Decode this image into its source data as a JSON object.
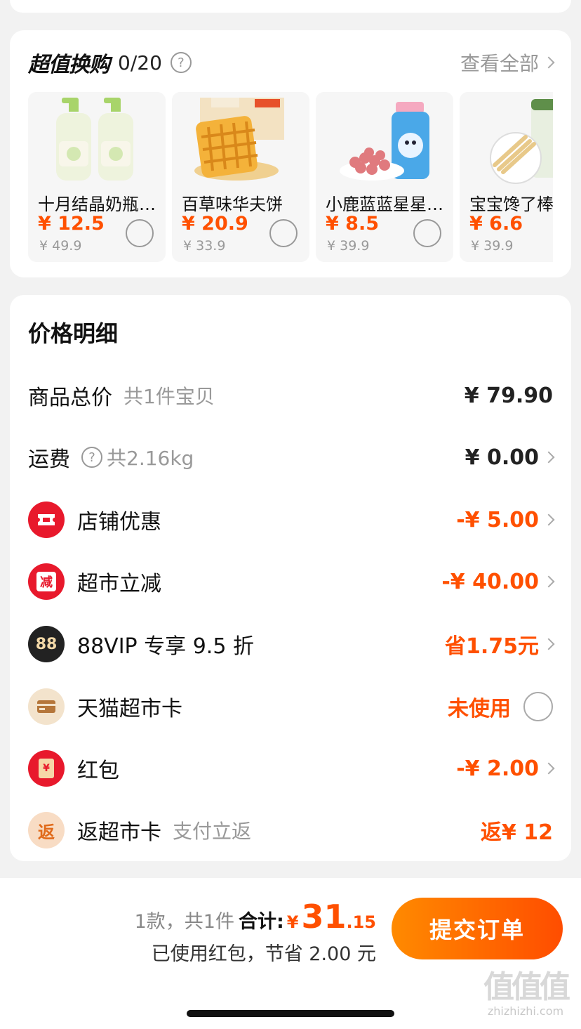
{
  "exchange": {
    "title": "超值换购",
    "count": "0/20",
    "help": "?",
    "view_all": "查看全部",
    "products": [
      {
        "name": "十月结晶奶瓶清洗剂",
        "price": "¥ 12.5",
        "orig": "¥ 49.9",
        "icon": "bottle-cleaner-image"
      },
      {
        "name": "百草味华夫饼",
        "price": "¥ 20.9",
        "orig": "¥ 33.9",
        "icon": "waffle-image"
      },
      {
        "name": "小鹿蓝蓝星星泡芙",
        "price": "¥ 8.5",
        "orig": "¥ 39.9",
        "icon": "puffs-image"
      },
      {
        "name": "宝宝馋了棒",
        "price": "¥ 6.6",
        "orig": "¥ 39.9",
        "icon": "baby-sticks-image"
      }
    ]
  },
  "price_detail": {
    "title": "价格明细",
    "rows": [
      {
        "label": "商品总价",
        "sub": "共1件宝贝",
        "value": "¥ 79.90"
      },
      {
        "label": "运费",
        "help": "?",
        "sub": "共2.16kg",
        "value": "¥ 0.00"
      },
      {
        "label": "店铺优惠",
        "value": "-¥ 5.00",
        "icon": "coupon-icon"
      },
      {
        "label": "超市立减",
        "value": "-¥ 40.00",
        "icon": "reduce-icon",
        "icon_text": "减"
      },
      {
        "label": "88VIP 专享 9.5 折",
        "value": "省1.75元",
        "icon": "vip-88-icon",
        "icon_text": "88"
      },
      {
        "label": "天猫超市卡",
        "value": "未使用",
        "icon": "card-icon"
      },
      {
        "label": "红包",
        "value": "-¥ 2.00",
        "icon": "red-packet-icon",
        "icon_text": "¥"
      },
      {
        "label": "返超市卡",
        "sub": "支付立返",
        "value": "返¥ 12",
        "icon": "cashback-icon",
        "icon_text": "返"
      }
    ]
  },
  "summary": {
    "count": "1款，共1件",
    "total_label": "合计:",
    "yen": "¥",
    "total_int": "31",
    "total_dec": ".15",
    "saved": "已使用红包，节省 2.00 元",
    "submit": "提交订单"
  },
  "watermark": {
    "logo": "值值值",
    "url": "zhizhizhi.com"
  },
  "colors": {
    "accent": "#ff5000",
    "red": "#e8192c",
    "dark": "#222222",
    "beige": "#f3e3cc"
  }
}
